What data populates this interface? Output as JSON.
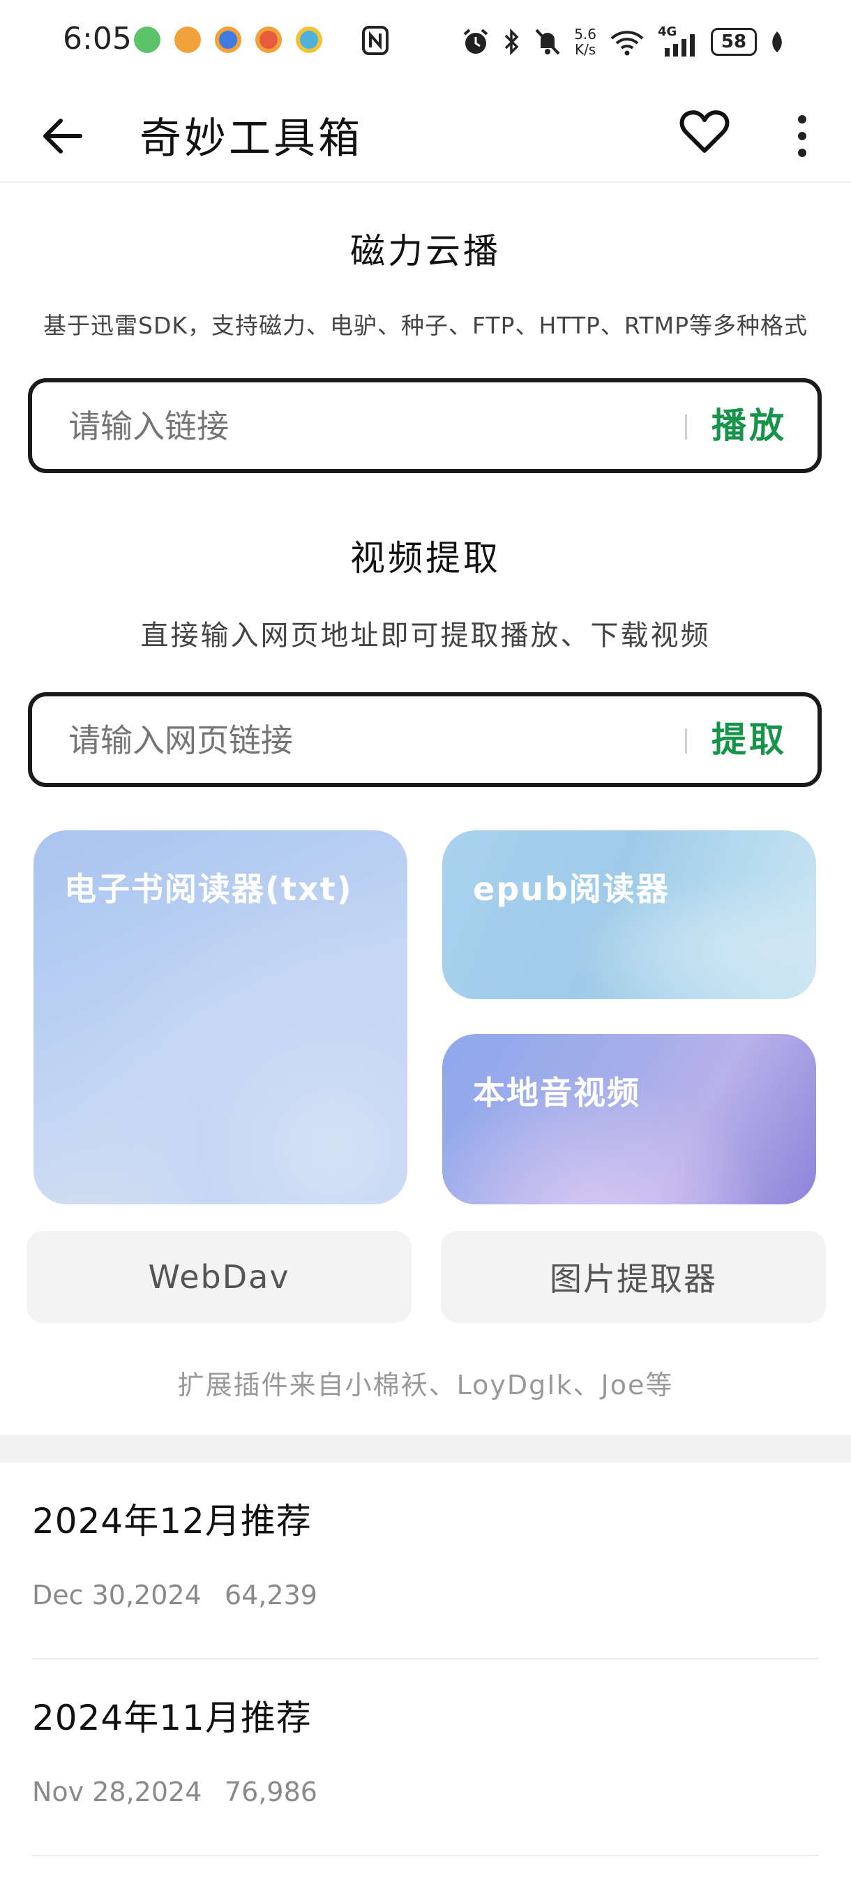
{
  "status_bar": {
    "time": "6:05",
    "net_speed_value": "5.6",
    "net_speed_unit": "K/s",
    "signal_label": "4G",
    "battery": "58",
    "notif_colors": [
      "#5cc36a",
      "#f2a23a",
      "#3d7be0",
      "#e65c3a",
      "#4fb1d9"
    ]
  },
  "app_bar": {
    "title": "奇妙工具箱",
    "icons": [
      "arrow-left-icon",
      "heart-outline-icon",
      "more-vertical-icon"
    ]
  },
  "magnet": {
    "title": "磁力云播",
    "subtitle": "基于迅雷SDK，支持磁力、电驴、种子、FTP、HTTP、RTMP等多种格式",
    "placeholder": "请输入链接",
    "action": "播放"
  },
  "video": {
    "title": "视频提取",
    "subtitle": "直接输入网页地址即可提取播放、下载视频",
    "placeholder": "请输入网页链接",
    "action": "提取"
  },
  "cards": {
    "ebook": "电子书阅读器(txt)",
    "epub": "epub阅读器",
    "media": "本地音视频"
  },
  "buttons": {
    "webdav": "WebDav",
    "image_extractor": "图片提取器"
  },
  "credit": "扩展插件来自小棉袄、LoyDgIk、Joe等",
  "recommendations": [
    {
      "title": "2024年12月推荐",
      "date": "Dec 30,2024",
      "views": "64,239"
    },
    {
      "title": "2024年11月推荐",
      "date": "Nov 28,2024",
      "views": "76,986"
    }
  ],
  "colors": {
    "accent_green": "#15944a"
  }
}
